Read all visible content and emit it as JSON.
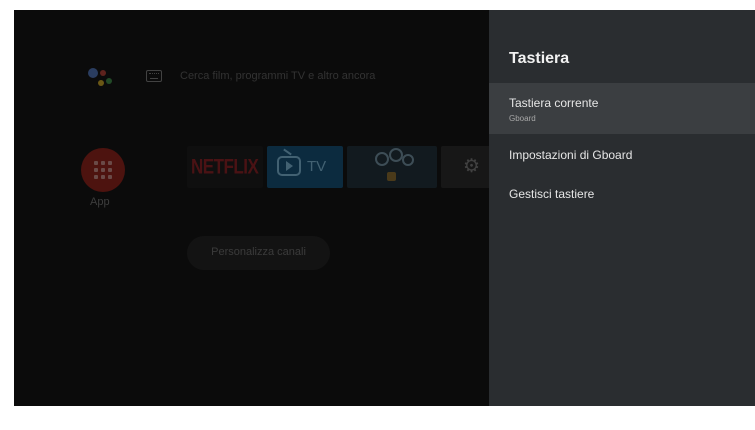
{
  "home": {
    "search_text": "Cerca film, programmi TV e altro ancora",
    "apps_label": "App",
    "tiles": {
      "netflix": "NETFLIX",
      "tv": "TV"
    },
    "customize_channels": "Personalizza canali"
  },
  "panel": {
    "title": "Tastiera",
    "items": [
      {
        "title": "Tastiera corrente",
        "subtitle": "Gboard",
        "selected": true
      },
      {
        "title": "Impostazioni di Gboard"
      },
      {
        "title": "Gestisci tastiere"
      }
    ]
  },
  "colors": {
    "panel_bg": "#2a2d30",
    "selected_item_bg": "#3b3e41",
    "screen_bg": "#0b0b0b"
  }
}
